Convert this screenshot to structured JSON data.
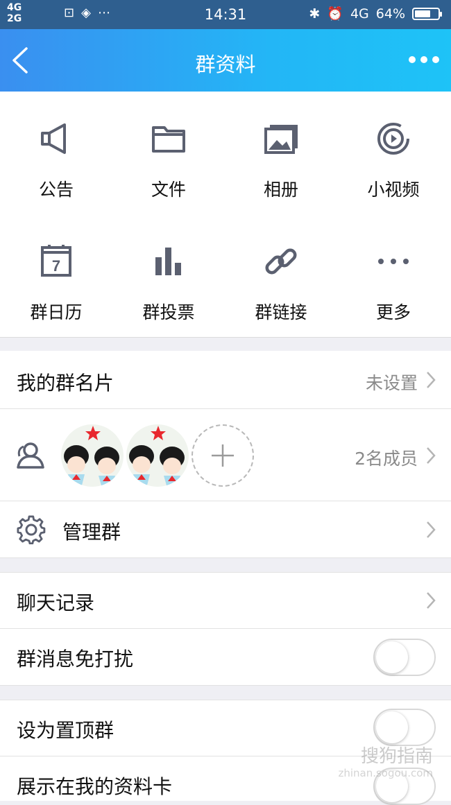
{
  "status_bar": {
    "signal_top": "4G",
    "signal_bottom": "2G",
    "time": "14:31",
    "network": "4G",
    "battery": "64%"
  },
  "nav": {
    "title": "群资料",
    "back_icon": "back-arrow-icon",
    "more_icon": "more-dots-icon"
  },
  "grid": {
    "items": [
      {
        "label": "公告",
        "icon": "megaphone-icon"
      },
      {
        "label": "文件",
        "icon": "folder-icon"
      },
      {
        "label": "相册",
        "icon": "photo-album-icon"
      },
      {
        "label": "小视频",
        "icon": "video-play-icon"
      },
      {
        "label": "群日历",
        "icon": "calendar-icon"
      },
      {
        "label": "群投票",
        "icon": "bar-chart-icon"
      },
      {
        "label": "群链接",
        "icon": "link-icon"
      },
      {
        "label": "更多",
        "icon": "more-horizontal-icon"
      }
    ],
    "calendar_day": "7"
  },
  "card": {
    "label": "我的群名片",
    "value": "未设置"
  },
  "members": {
    "count_text": "2名成员"
  },
  "manage": {
    "label": "管理群"
  },
  "chat_history": {
    "label": "聊天记录"
  },
  "do_not_disturb": {
    "label": "群消息免打扰",
    "on": false
  },
  "pin_group": {
    "label": "设为置顶群",
    "on": false
  },
  "show_on_profile": {
    "label": "展示在我的资料卡",
    "on": false
  },
  "watermark": {
    "text": "搜狗指南",
    "url": "zhinan.sogou.com"
  },
  "colors": {
    "nav_gradient_start": "#3a8ff0",
    "nav_gradient_end": "#1ec3f7",
    "icon_gray": "#5b6070",
    "background": "#efeff4"
  }
}
